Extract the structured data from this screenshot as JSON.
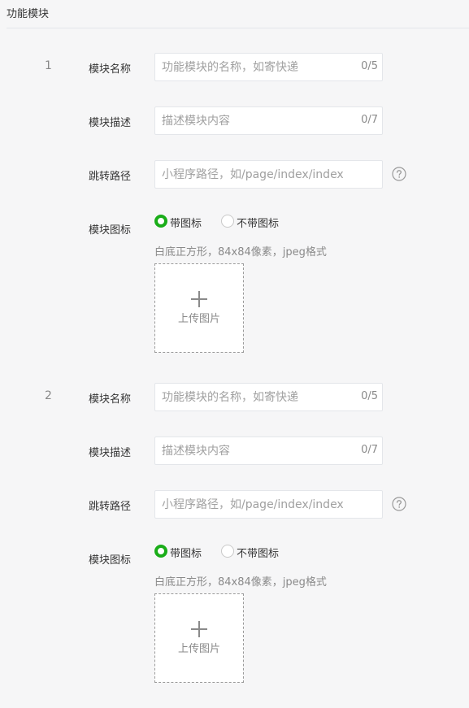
{
  "section": {
    "title": "功能模块"
  },
  "modules": [
    {
      "index": "1",
      "name_label": "模块名称",
      "name_placeholder": "功能模块的名称，如寄快递",
      "name_counter": "0/5",
      "desc_label": "模块描述",
      "desc_placeholder": "描述模块内容",
      "desc_counter": "0/7",
      "path_label": "跳转路径",
      "path_placeholder": "小程序路径，如/page/index/index",
      "icon_label": "模块图标",
      "icon_option_with": "带图标",
      "icon_option_without": "不带图标",
      "icon_selected": "带图标",
      "icon_hint": "白底正方形，84x84像素，jpeg格式",
      "upload_label": "上传图片"
    },
    {
      "index": "2",
      "name_label": "模块名称",
      "name_placeholder": "功能模块的名称，如寄快递",
      "name_counter": "0/5",
      "desc_label": "模块描述",
      "desc_placeholder": "描述模块内容",
      "desc_counter": "0/7",
      "path_label": "跳转路径",
      "path_placeholder": "小程序路径，如/page/index/index",
      "icon_label": "模块图标",
      "icon_option_with": "带图标",
      "icon_option_without": "不带图标",
      "icon_selected": "带图标",
      "icon_hint": "白底正方形，84x84像素，jpeg格式",
      "upload_label": "上传图片"
    }
  ],
  "colors": {
    "accent": "#1aad19",
    "border": "#e4e6ea",
    "background": "#f6f6f7"
  }
}
